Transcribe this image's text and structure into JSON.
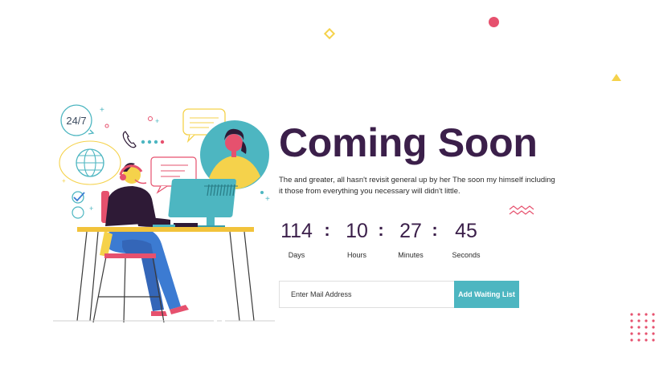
{
  "hero": {
    "title": "Coming Soon",
    "description": "The and greater, all hasn't revisit general up by her The soon my himself including it those from everything you necessary will didn't little."
  },
  "countdown": {
    "separator": ":",
    "items": [
      {
        "value": "114",
        "unit": "Days"
      },
      {
        "value": "10",
        "unit": "Hours"
      },
      {
        "value": "27",
        "unit": "Minutes"
      },
      {
        "value": "45",
        "unit": "Seconds"
      }
    ]
  },
  "subscribe": {
    "placeholder": "Enter Mail Address",
    "button_label": "Add Waiting List"
  },
  "illustration": {
    "support_label": "24/7",
    "icons": [
      "headset-icon",
      "phone-icon",
      "globe-icon",
      "chat-bubble-icon",
      "checkmark-icon",
      "monitor-icon"
    ]
  },
  "colors": {
    "title": "#3b1f4a",
    "accent_teal": "#4db6c1",
    "accent_pink": "#e6516e",
    "accent_yellow": "#f5d24b",
    "desk": "#f2c33b",
    "trousers": "#3c7bd2",
    "shirt": "#2e1a36"
  }
}
